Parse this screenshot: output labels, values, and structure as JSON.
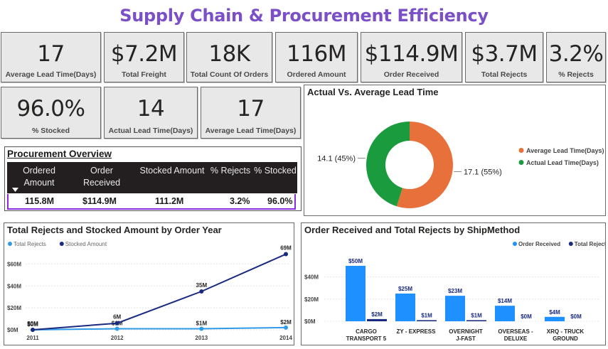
{
  "title": "Supply Chain & Procurement Efficiency",
  "cards_row1": [
    {
      "value": "17",
      "label": "Average Lead Time(Days)"
    },
    {
      "value": "$7.2M",
      "label": "Total Freight"
    },
    {
      "value": "18K",
      "label": "Total Count Of Orders"
    },
    {
      "value": "116M",
      "label": "Ordered Amount"
    },
    {
      "value": "$114.9M",
      "label": "Order Received"
    },
    {
      "value": "$3.7M",
      "label": "Total Rejects"
    },
    {
      "value": "3.2%",
      "label": "% Rejects"
    }
  ],
  "cards_row2": [
    {
      "value": "96.0%",
      "label": "% Stocked"
    },
    {
      "value": "14",
      "label": "Actual Lead Time(Days)"
    },
    {
      "value": "17",
      "label": "Average Lead Time(Days)"
    }
  ],
  "procurement": {
    "title": "Procurement Overview",
    "headers": [
      "Ordered Amount",
      "Order Received",
      "Stocked Amount",
      "% Rejects",
      "% Stocked"
    ],
    "headers_line1": [
      "Ordered",
      "Order",
      "Stocked Amount",
      "% Rejects",
      "% Stocked"
    ],
    "headers_line2": [
      "Amount",
      "Received",
      "",
      "",
      ""
    ],
    "row": [
      "115.8M",
      "$114.9M",
      "111.2M",
      "3.2%",
      "96.0%"
    ]
  },
  "chart_data": [
    {
      "type": "pie",
      "title": "Actual Vs. Average Lead Time",
      "legend_position": "right",
      "series": [
        {
          "name": "Average Lead Time(Days)",
          "value": 17.1,
          "label": "17.1 (55%)",
          "color": "#e8703a"
        },
        {
          "name": "Actual Lead Time(Days)",
          "value": 14.1,
          "label": "14.1 (45%)",
          "color": "#1a9c3e"
        }
      ]
    },
    {
      "type": "line",
      "title": "Total Rejects and Stocked Amount by Order Year",
      "legend_position": "top-left",
      "x": [
        "2011",
        "2012",
        "2013",
        "2014"
      ],
      "ylim": [
        0,
        70
      ],
      "yticks": [
        "$0M",
        "$20M",
        "$40M",
        "$60M"
      ],
      "series": [
        {
          "name": "Total Rejects",
          "color": "#2f9be8",
          "values": [
            0,
            1,
            1,
            2
          ],
          "labels": [
            "$0M",
            "$1M",
            "$1M",
            "$2M"
          ]
        },
        {
          "name": "Stocked Amount",
          "color": "#1a2a80",
          "values": [
            0,
            6,
            35,
            69
          ],
          "labels": [
            "$0M",
            "6M",
            "35M",
            "69M"
          ]
        }
      ]
    },
    {
      "type": "bar",
      "title": "Order Received and Total Rejects by ShipMethod",
      "legend_position": "top-right",
      "categories": [
        "CARGO TRANSPORT 5",
        "ZY - EXPRESS",
        "OVERNIGHT J-FAST",
        "OVERSEAS - DELUXE",
        "XRQ - TRUCK GROUND"
      ],
      "category_lines": [
        [
          "CARGO",
          "TRANSPORT 5"
        ],
        [
          "ZY - EXPRESS"
        ],
        [
          "OVERNIGHT",
          "J-FAST"
        ],
        [
          "OVERSEAS -",
          "DELUXE"
        ],
        [
          "XRQ - TRUCK",
          "GROUND"
        ]
      ],
      "ylim": [
        0,
        50
      ],
      "yticks": [
        "$0M",
        "$20M",
        "$40M"
      ],
      "series": [
        {
          "name": "Order Received",
          "color": "#1e90ff",
          "values": [
            50,
            25,
            23,
            14,
            4
          ],
          "labels": [
            "$50M",
            "$25M",
            "$23M",
            "$14M",
            "$4M"
          ]
        },
        {
          "name": "Total Rejects",
          "color": "#1a2a80",
          "values": [
            2,
            1,
            1,
            0,
            0
          ],
          "labels": [
            "$2M",
            "$1M",
            "$1M",
            "$0M",
            "$0M"
          ]
        }
      ]
    }
  ]
}
